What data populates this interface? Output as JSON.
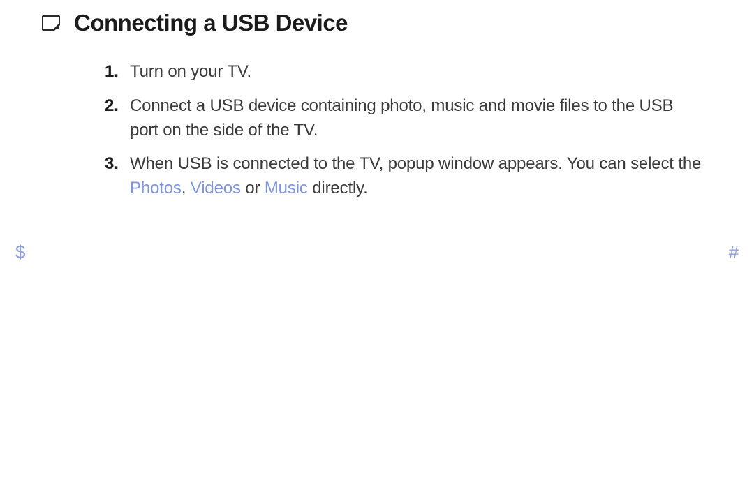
{
  "heading": "Connecting a USB Device",
  "steps": {
    "n1": "1.",
    "t1": "Turn on your TV.",
    "n2": "2.",
    "t2": "Connect a USB device containing photo, music and movie files to the USB port on the side of the TV.",
    "n3": "3.",
    "t3_a": "When USB is connected to the TV, popup window appears. You can select the ",
    "t3_photos": "Photos",
    "t3_sep1": ", ",
    "t3_videos": "Videos",
    "t3_sep2": " or ",
    "t3_music": "Music",
    "t3_b": " directly."
  },
  "nav": {
    "prev": "$",
    "next": "#"
  }
}
